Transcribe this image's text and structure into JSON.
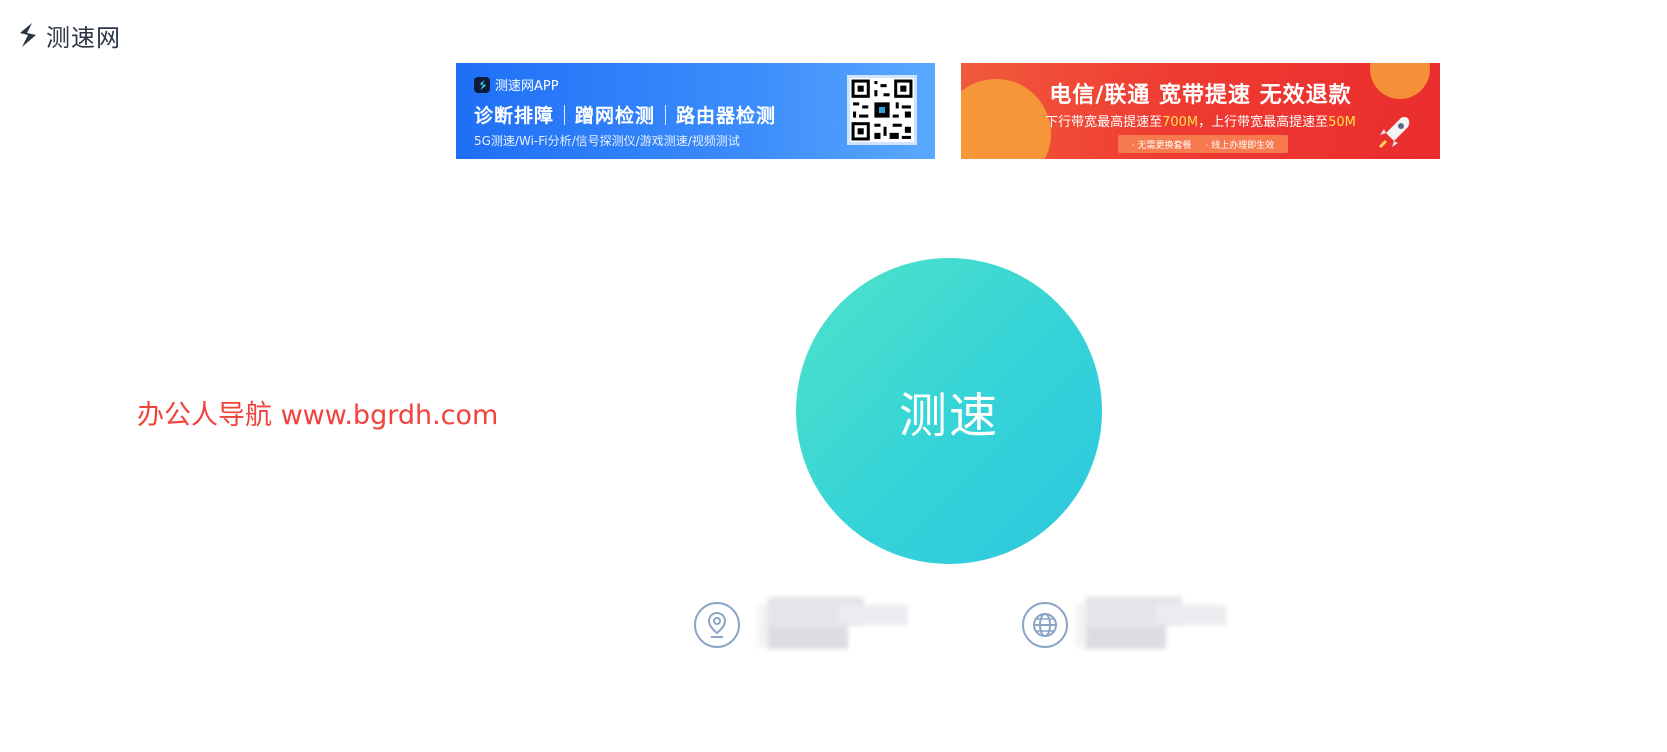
{
  "site": {
    "name": "测速网"
  },
  "banner_app": {
    "title": "测速网APP",
    "features": [
      "诊断排障",
      "蹭网检测",
      "路由器检测"
    ],
    "subtitle": "5G测速/Wi-Fi分析/信号探测仪/游戏测速/视频测试"
  },
  "banner_promo": {
    "title": "电信/联通 宽带提速 无效退款",
    "line_prefix": "下行带宽最高提速至",
    "line_down": "700M",
    "line_mid": "，上行带宽最高提速至",
    "line_up": "50M",
    "pill_left": "· 无需更换套餐",
    "pill_right": "· 线上办理即生效"
  },
  "watermark": "办公人导航 www.bgrdh.com",
  "speed_button": {
    "label": "测速"
  },
  "info": {
    "location_icon": "location-pin-icon",
    "network_icon": "globe-icon"
  },
  "colors": {
    "accent_start": "#4fe3c9",
    "accent_end": "#2cc7df",
    "watermark": "#f2423c",
    "banner_blue": "#1f6ff6",
    "banner_red": "#ef3b32"
  }
}
